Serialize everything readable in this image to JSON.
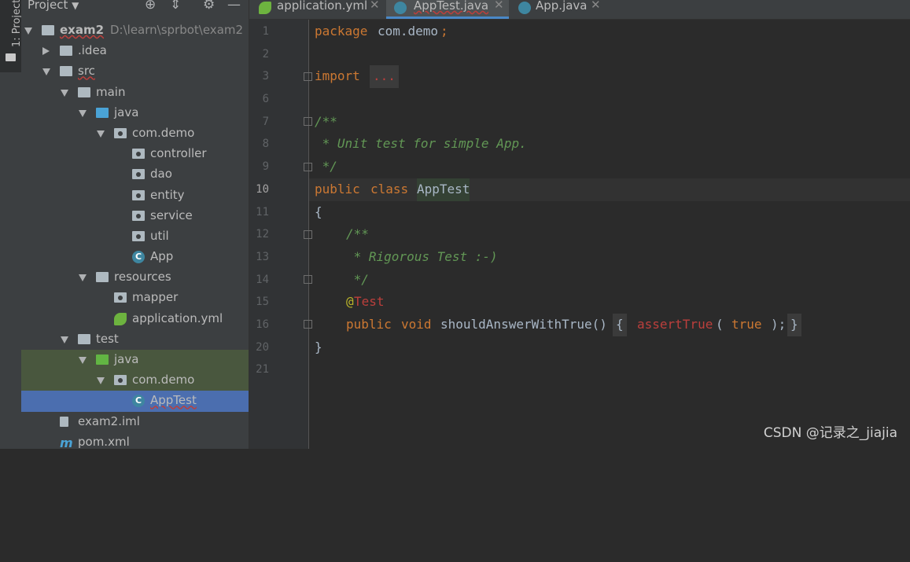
{
  "toolwindow_tab": "1: Project",
  "project_panel": {
    "title": "Project",
    "dropdown_icon": "chevron-down-icon",
    "icons": [
      "locate-icon",
      "collapse-icon",
      "gear-icon",
      "minimize-icon"
    ]
  },
  "tree": [
    {
      "label": "exam2",
      "sub": "D:\\learn\\sprbot\\exam2",
      "icon": "folder",
      "arrow": "down",
      "level": 0
    },
    {
      "label": ".idea",
      "icon": "folder",
      "arrow": "right",
      "level": 1
    },
    {
      "label": "src",
      "icon": "folder",
      "arrow": "down",
      "level": 1
    },
    {
      "label": "main",
      "icon": "folder",
      "arrow": "down",
      "level": 2
    },
    {
      "label": "java",
      "icon": "source-folder",
      "arrow": "down",
      "level": 3
    },
    {
      "label": "com.demo",
      "icon": "package",
      "arrow": "down",
      "level": 4
    },
    {
      "label": "controller",
      "icon": "package",
      "level": 5
    },
    {
      "label": "dao",
      "icon": "package",
      "level": 5
    },
    {
      "label": "entity",
      "icon": "package",
      "level": 5
    },
    {
      "label": "service",
      "icon": "package",
      "level": 5
    },
    {
      "label": "util",
      "icon": "package",
      "level": 5
    },
    {
      "label": "App",
      "icon": "class",
      "level": 5
    },
    {
      "label": "resources",
      "icon": "resources-folder",
      "arrow": "down",
      "level": 3
    },
    {
      "label": "mapper",
      "icon": "package",
      "level": 4
    },
    {
      "label": "application.yml",
      "icon": "spring",
      "level": 4
    },
    {
      "label": "test",
      "icon": "folder",
      "arrow": "down",
      "level": 2
    },
    {
      "label": "java",
      "icon": "test-folder",
      "arrow": "down",
      "level": 3
    },
    {
      "label": "com.demo",
      "icon": "package",
      "arrow": "down",
      "level": 4
    },
    {
      "label": "AppTest",
      "icon": "class",
      "level": 5
    },
    {
      "label": "exam2.iml",
      "icon": "module",
      "level": 1
    },
    {
      "label": "pom.xml",
      "icon": "maven",
      "level": 1
    }
  ],
  "tabs": [
    {
      "label": "application.yml",
      "icon": "spring",
      "active": false
    },
    {
      "label": "AppTest.java",
      "icon": "class",
      "active": true
    },
    {
      "label": "App.java",
      "icon": "class",
      "active": false
    }
  ],
  "line_numbers": [
    "1",
    "2",
    "3",
    "6",
    "7",
    "8",
    "9",
    "10",
    "11",
    "12",
    "13",
    "14",
    "15",
    "16",
    "20",
    "21"
  ],
  "code": {
    "package_kw": "package",
    "package_name": "com.demo",
    "semicolon": ";",
    "import_kw": "import",
    "import_fold": "...",
    "doc_open": "/**",
    "doc_line": " * Unit test for simple App.",
    "doc_close": " */",
    "public_kw": "public",
    "class_kw": "class",
    "class_name": "AppTest",
    "open_brace": "{",
    "doc2_open": "/**",
    "doc2_line": " * Rigorous Test :-)",
    "doc2_close": " */",
    "annot_at": "@",
    "annot_name": "Test",
    "void_kw": "void",
    "method_name": "shouldAnswerWithTrue()",
    "body_open": "{",
    "assert_fn": "assertTrue",
    "paren_open": "(",
    "true_kw": "true",
    "paren_close": ");",
    "body_close": "}",
    "close_brace": "}"
  },
  "watermark": "CSDN @记录之_jiajia"
}
